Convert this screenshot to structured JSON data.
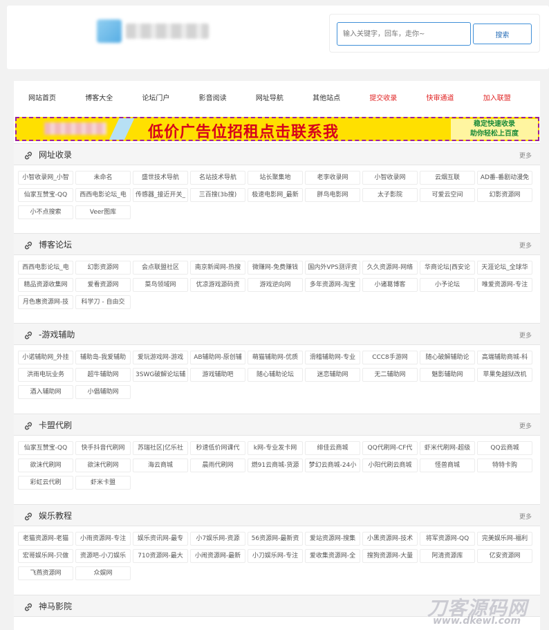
{
  "search": {
    "placeholder": "输入关键字，回车，走你~",
    "button": "搜索"
  },
  "nav": [
    "网站首页",
    "博客大全",
    "论坛门户",
    "影音阅读",
    "网址导航",
    "其他站点",
    "提交收录",
    "快审通道",
    "加入联盟"
  ],
  "nav_highlight": [
    6,
    7,
    8
  ],
  "colors": {
    "accent_blue": "#3f8fd8",
    "nav_red": "#e02424",
    "banner_yellow": "#ffe000",
    "banner_border": "#9c1f9c",
    "banner_text": "#d6001c",
    "banner_side_text": "#1a8a3a"
  },
  "banner": {
    "main": "低价广告位招租点击联系我",
    "side1": "稳定快速收录",
    "side2": "助你轻松上百度"
  },
  "more_label": "更多",
  "sections": [
    {
      "title": "网址收录",
      "items": [
        "小智收录网_小智",
        "未命名",
        "盛世技术导航",
        "名站技术导航",
        "站长聚集地",
        "老李收录网",
        "小智收录网",
        "云烟互联",
        "AD番-番剧动漫免",
        "仙家互赞宝-QQ",
        "西西电影论坛_电",
        "传感器_接近开关_",
        "三百搜(3b搜)",
        "极速电影网_最新",
        "胖鸟电影网",
        "太子影院",
        "可爱云空间",
        "幻影资源网",
        "小不点搜索",
        "Veer图库"
      ]
    },
    {
      "title": "博客论坛",
      "items": [
        "西西电影论坛_电",
        "幻影资源网",
        "会点联盟社区",
        "南京新闻网-热搜",
        "微赚网-免费赚钱",
        "国内外VPS测评资",
        "久久资源网-网络",
        "华商论坛|西安论",
        "天涯论坛_全球华",
        "精品资源收集网",
        "爱看资源网",
        "菜鸟领域网",
        "优凉游戏源码资",
        "游戏逆向网",
        "多年资源网-淘宝",
        "小诸葛博客",
        "小予论坛",
        "唯爱资源网-专注",
        "月色惠资源网-技",
        "科学刀 - 自由交"
      ]
    },
    {
      "title": "-游戏辅助",
      "items": [
        "小诺辅助网_外挂",
        "辅助岛-我爱辅助",
        "爱玩游戏网-游戏",
        "AB辅助网-原创辅",
        "萌猫辅助网-优质",
        "滑稽辅助网-专业",
        "CCC8手游网",
        "随心破解辅助论",
        "高端辅助商城-科",
        "洪雨电玩业务",
        "超牛辅助网",
        "3SWG破解论坛辅",
        "游戏辅助吧",
        "随心辅助论坛",
        "迷恋辅助网",
        "无二辅助网",
        "魅影辅助网",
        "苹果免越狱改机",
        "酒入辅助网",
        "小倡辅助网"
      ]
    },
    {
      "title": "卡盟代刷",
      "items": [
        "仙家互赞宝-QQ",
        "快手抖音代刷网",
        "苏瑞社区|亿乐社",
        "秒速低价网课代",
        "k网-专业发卡网",
        "绯佳云商城",
        "QQ代刷网-CF代",
        "虾米代刷网-超级",
        "QQ云商城",
        "欲沫代刷网",
        "欲沫代刷网",
        "海云商城",
        "晨雨代刷网",
        "燃91云商城-货源",
        "梦幻云商城-24小",
        "小阳代刷云商城",
        "怪兽商城",
        "特特卡购",
        "彩虹云代刷",
        "虾米卡盟"
      ]
    },
    {
      "title": "娱乐教程",
      "items": [
        "老猫资源网-老猫",
        "小雨资源网-专注",
        "娱乐资讯网-最专",
        "小7娱乐网-资源",
        "56资源网-最新资",
        "爱站资源网-搜集",
        "小黑资源网-技术",
        "将军资源网-QQ",
        "完美娱乐网-福利",
        "宏哥娱乐网-只做",
        "资源吧-小刀娱乐",
        "710资源网-最大",
        "小闹资源网-最新",
        "小刀娱乐网-专注",
        "爱收集资源网-全",
        "搜狗资源网-大量",
        "阿清资源库",
        "亿安资源网",
        "飞燕资源网",
        "众娱网"
      ]
    },
    {
      "title": "神马影院",
      "items": []
    }
  ],
  "watermark": {
    "line1": "刀客源码网",
    "line2": "www.dkewl.com"
  }
}
